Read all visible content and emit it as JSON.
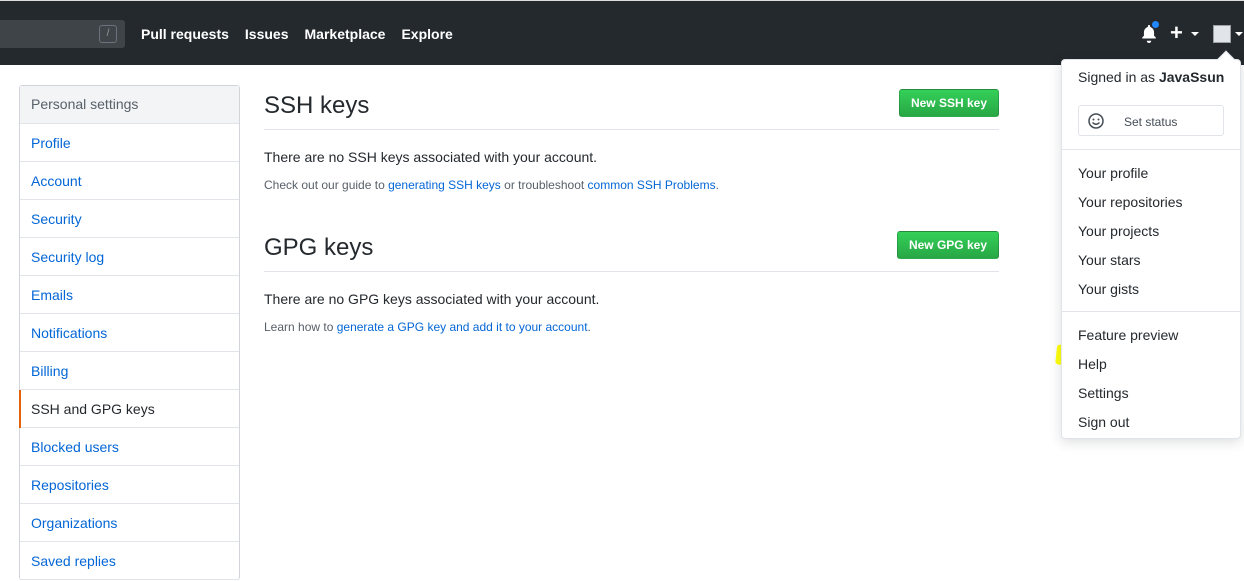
{
  "header": {
    "search_shortcut": "/",
    "nav": [
      "Pull requests",
      "Issues",
      "Marketplace",
      "Explore"
    ]
  },
  "sidebar": {
    "heading": "Personal settings",
    "items": [
      {
        "label": "Profile",
        "selected": false
      },
      {
        "label": "Account",
        "selected": false
      },
      {
        "label": "Security",
        "selected": false
      },
      {
        "label": "Security log",
        "selected": false
      },
      {
        "label": "Emails",
        "selected": false
      },
      {
        "label": "Notifications",
        "selected": false
      },
      {
        "label": "Billing",
        "selected": false
      },
      {
        "label": "SSH and GPG keys",
        "selected": true
      },
      {
        "label": "Blocked users",
        "selected": false
      },
      {
        "label": "Repositories",
        "selected": false
      },
      {
        "label": "Organizations",
        "selected": false
      },
      {
        "label": "Saved replies",
        "selected": false
      }
    ]
  },
  "ssh": {
    "title": "SSH keys",
    "button": "New SSH key",
    "empty": "There are no SSH keys associated with your account.",
    "help_prefix": "Check out our guide to ",
    "help_link1": "generating SSH keys",
    "help_middle": " or troubleshoot ",
    "help_link2": "common SSH Problems",
    "help_suffix": "."
  },
  "gpg": {
    "title": "GPG keys",
    "button": "New GPG key",
    "empty": "There are no GPG keys associated with your account.",
    "help_prefix": "Learn how to ",
    "help_link": "generate a GPG key and add it to your account",
    "help_suffix": "."
  },
  "dropdown": {
    "signed_prefix": "Signed in as ",
    "username": "JavaSsun",
    "set_status": "Set status",
    "profile_items": [
      "Your profile",
      "Your repositories",
      "Your projects",
      "Your stars",
      "Your gists"
    ],
    "other_items": [
      "Feature preview",
      "Help",
      "Settings",
      "Sign out"
    ]
  },
  "colors": {
    "header_bg": "#24292e",
    "link": "#0366d6",
    "button_green": "#28a745",
    "selected_accent": "#e36209",
    "highlight": "#ffff00"
  }
}
